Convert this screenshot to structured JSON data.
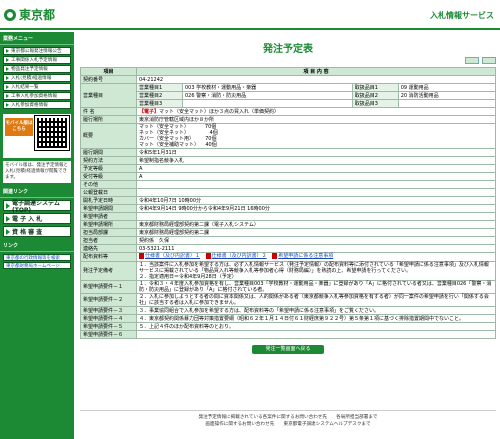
{
  "header": {
    "logo_text": "東京都",
    "service_name": "入札情報サービス"
  },
  "sidebar": {
    "menu_title": "業務メニュー",
    "items": [
      "東京都公報発注情報公告",
      "工事関係入札予定情報",
      "物品発注予定情報",
      "入札(見積)経過情報",
      "入札結果一覧",
      "工事入札参加資格情報",
      "入札参加資格情報"
    ],
    "mobile_badge": "モバイル版はこちら",
    "mobile_note": "モバイル版は、発注予定情報と入札(見積)経過情報が閲覧できます。",
    "links_title": "関連リンク",
    "big_links": [
      "電子調達システム(TOP)",
      "電 子 入 札",
      "資 格 審 査"
    ],
    "sub_title": "リンク",
    "sub_links": [
      "東京都の行政情報等を検索",
      "東京都財務局ホームページ"
    ]
  },
  "main": {
    "title": "発注予定表",
    "col_item": "項目",
    "col_content": "項 目 内 容",
    "contract_no_label": "契約番号",
    "contract_no": "04-21242",
    "biz_type_label": "営業種目",
    "biz_rows": [
      {
        "label": "営業種目1",
        "value": "003 学校教材・運動用品・楽器",
        "grade_label": "取扱品目1",
        "grade": "09 運動用品"
      },
      {
        "label": "営業種目2",
        "value": "026 警察・消防・防災用品",
        "grade_label": "取扱品目2",
        "grade": "20 消防活動用品"
      },
      {
        "label": "営業種目3",
        "value": "",
        "grade_label": "取扱品目3",
        "grade": ""
      }
    ],
    "item_name_label": "件 名",
    "item_tag": "【電子】",
    "item_name": "マット（安全マット）ほか３点の買入れ（単価契約）",
    "place_label": "履行場所",
    "place": "東京消防庁管轄区域内ほか８か所",
    "summary_label": "概要",
    "summary_lines": [
      "マット（安全マット）          70個",
      "ネット（安全ネット）             4個",
      "カバー（安全マット用）       70個",
      "マット（安全補助マット）    40個"
    ],
    "period_label": "履行期間",
    "period": "令和5年1月31日",
    "method_label": "契約方法",
    "method": "希望制指名競争入札",
    "grade_label": "予定等級",
    "grade_value": "A",
    "accept_label": "受付等級",
    "accept_value": "A",
    "other_label": "その他",
    "other_value": "",
    "announce_label": "公報登載日",
    "announce_value": "",
    "open_label": "開札予定日時",
    "open_value": "令和4年10月7日 10時00分",
    "apply_label": "希望申請期間",
    "apply_value": "令和4年9月14日 9時00分から令和4年9月21日 16時00分",
    "applicant_label": "希望申請者",
    "applicant_value": "",
    "window_label": "希望申請場所",
    "window_value": "東京都財務局経理部契約第二課（電子入札システム）",
    "dept_label": "担当局部課",
    "dept_value": "東京都財務局経理部契約第二課",
    "person_label": "担当者",
    "person_value": "契約係　久保",
    "phone_label": "連絡先",
    "phone_value": "03-5321-2111",
    "docs_label": "配布資料等",
    "docs": [
      "仕様書（及び内訳書）１",
      "仕様書（及び内訳書）２",
      "希望申請に係る注意事項"
    ],
    "notes_label": "発注予定備考",
    "notes": [
      "１．当該案件に入札参加を希望する方は、必ず入札情報サービス（発注予定情報）の配布資料等に添付されている「希望申請に係る注意事項」及び入札情報サービスに掲載されている「物品買入れ等競争入札等参加者心得（財務局編）」を熟読の上、希望申請を行ってください。",
      "２．指定適用日＝令和4年9月28日（予定）"
    ],
    "conditions": [
      {
        "label": "希望申請要件－１",
        "text": "１．令和３・４年度入札参加資格を有し、営業種目003「学校教材・運動用品・楽器」に登録があり「A」に格付されている者又は、営業種目026「警察・消防・防災用品」に登録があり「A」に格付されている者。"
      },
      {
        "label": "希望申請要件－２",
        "text": "２．入札に参加しようとする者の間に資本関係又は、人的関係がある者（東京都競争入札等参加資格を有する者）が同一案件の希望申請を行い「関係する会社」に該当する者は入札に参加できません。"
      },
      {
        "label": "希望申請要件－３",
        "text": "３．事業協同組合で入札参加を希望する方は、配布資料等の「希望申請に係る注意事項」をご覧ください。"
      },
      {
        "label": "希望申請要件－４",
        "text": "４．東京都契約関係暴力団等対策措置要綱（昭和６２年１月１４日付６１財経庶第９２２号）第５条第１項に基づく排除措置期間中でないこと。"
      },
      {
        "label": "希望申請要件－５",
        "text": "５．上記４件のほか配布資料等のとおり。"
      },
      {
        "label": "希望申請要件－６",
        "text": ""
      }
    ],
    "back_button": "発注一覧画面へ戻る"
  },
  "footer": {
    "line1": "発注予定情報に掲載されている各案件に関するお問い合わせ先　　各局所担当部署まで",
    "line2": "画面操作に関するお問い合わせ先　　東京都電子調達システムヘルプデスクまで"
  },
  "colors": {
    "brand_green": "#1c8a34",
    "header_cell": "#cfe8d4",
    "tag_red": "#c00000"
  }
}
